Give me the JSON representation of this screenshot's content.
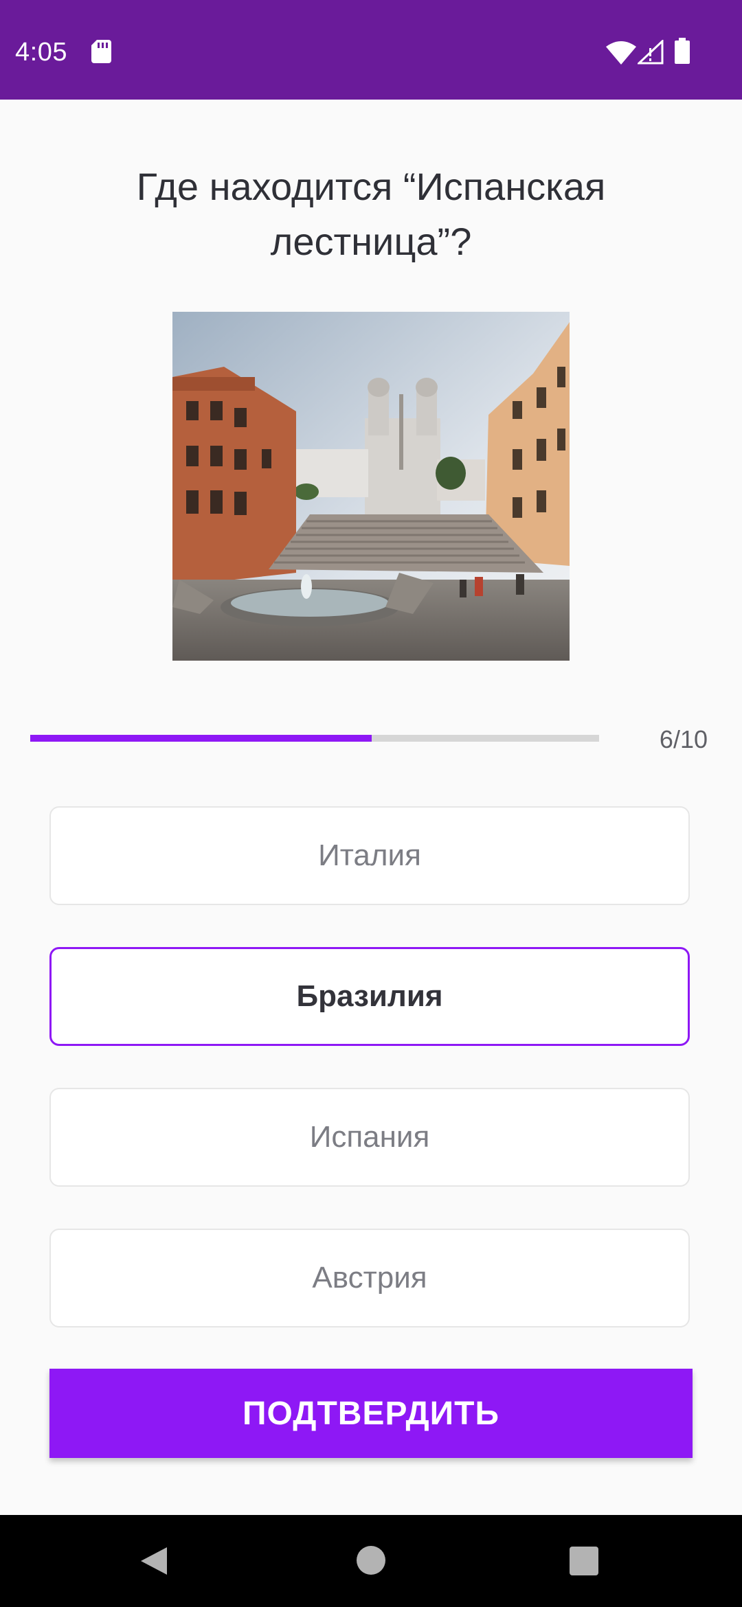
{
  "status_bar": {
    "time": "4:05",
    "icons": [
      "sd-card-icon",
      "wifi-icon",
      "signal-icon",
      "battery-icon"
    ],
    "background": "#6a1b9a"
  },
  "question": {
    "line1": "Где находится “Испанская",
    "line2": "лестница”?"
  },
  "image": {
    "subject": "Spanish Steps, Rome"
  },
  "progress": {
    "text": "6/10",
    "fraction": 0.6
  },
  "options": [
    {
      "label": "Италия",
      "selected": false
    },
    {
      "label": "Бразилия",
      "selected": true
    },
    {
      "label": "Испания",
      "selected": false
    },
    {
      "label": "Австрия",
      "selected": false
    }
  ],
  "confirm_button": {
    "label": "ПОДТВЕРДИТЬ"
  },
  "nav_bar": {
    "icons": [
      "back-icon",
      "home-icon",
      "recent-apps-icon"
    ]
  },
  "colors": {
    "accent": "#8e18f5",
    "status_bar": "#6a1b9a",
    "background": "#fafafa"
  }
}
